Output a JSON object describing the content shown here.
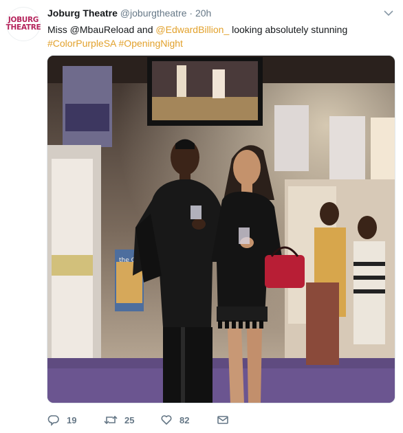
{
  "account": {
    "logo_line1": "JOBURG",
    "logo_line2": "THEATRE",
    "display_name": "Joburg Theatre",
    "handle": "@joburgtheatre",
    "separator": "·",
    "timestamp": "20h"
  },
  "tweet": {
    "text_part1": "Miss @MbauReload and ",
    "mention": "@EdwardBillion_",
    "text_part2": " looking absolutely stunning",
    "hashtag1": "#ColorPurpleSA",
    "hashtag2": "#OpeningNight"
  },
  "photo": {
    "poster_text": "the COLOR PURPLE"
  },
  "actions": {
    "replies": "19",
    "retweets": "25",
    "likes": "82"
  },
  "colors": {
    "link": "#e2a12b",
    "brand": "#b5245c",
    "muted": "#657786"
  },
  "icons": [
    "chevron-down-icon",
    "reply-icon",
    "retweet-icon",
    "heart-icon",
    "message-icon"
  ]
}
